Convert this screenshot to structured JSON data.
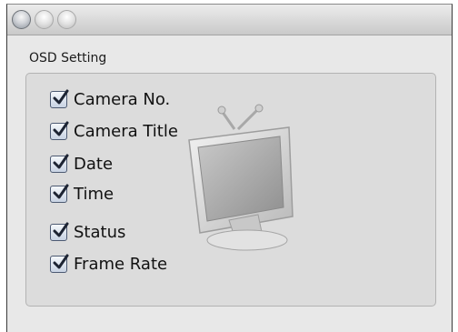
{
  "window": {
    "controls": [
      "close-button",
      "minimize-button",
      "zoom-button"
    ]
  },
  "osd": {
    "group_title": "OSD Setting",
    "options": [
      {
        "label": "Camera No.",
        "checked": true
      },
      {
        "label": "Camera Title",
        "checked": true
      },
      {
        "label": "Date",
        "checked": true
      },
      {
        "label": "Time",
        "checked": true
      },
      {
        "label": "Status",
        "checked": true
      },
      {
        "label": "Frame Rate",
        "checked": true
      }
    ]
  },
  "icons": {
    "watermark": "tv-monitor-icon",
    "check": "checkmark-icon"
  },
  "colors": {
    "check": "#1d2433",
    "checkbox_border": "#4d5a72",
    "panel": "#dcdcdc"
  }
}
